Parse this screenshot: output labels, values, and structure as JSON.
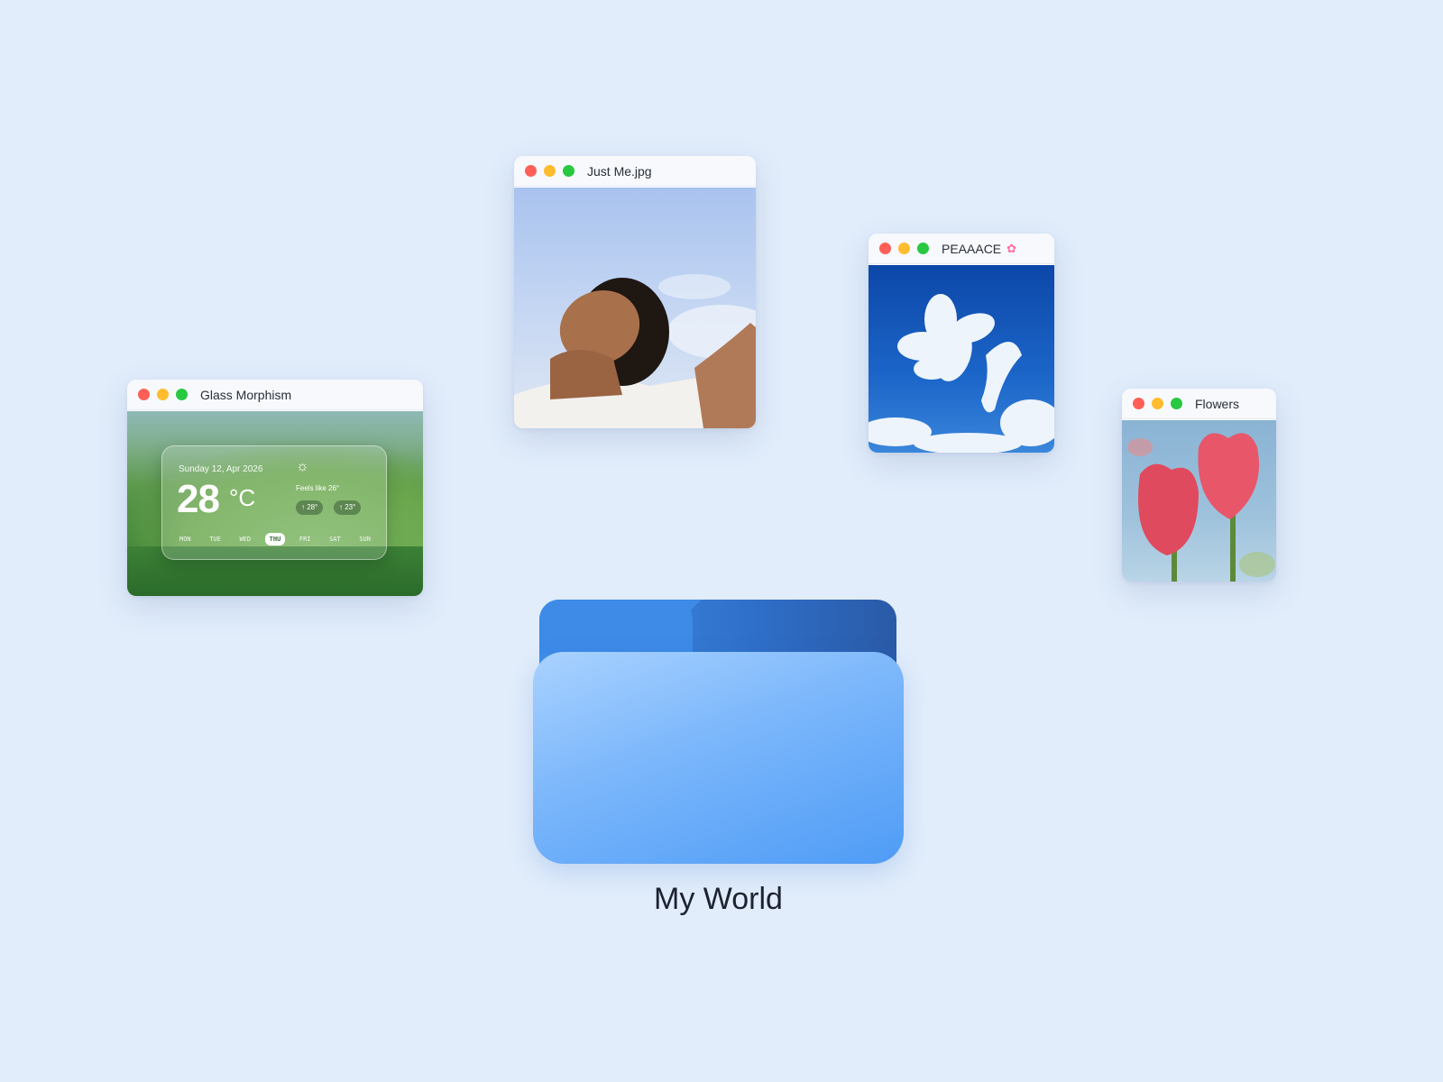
{
  "windows": {
    "weather": {
      "title": "Glass Morphism",
      "widget": {
        "date": "Sunday 12, Apr 2026",
        "temperature": "28",
        "unit": "°C",
        "feels_like": "Feels like 26°",
        "high": "↑ 28°",
        "low": "↑ 23°",
        "days": [
          "MON",
          "TUE",
          "WED",
          "THU",
          "FRI",
          "SAT",
          "SUN"
        ],
        "selected_day": "THU"
      }
    },
    "photo": {
      "title": "Just Me.jpg"
    },
    "cloud": {
      "title": "PEAAACE"
    },
    "flowers": {
      "title": "Flowers"
    }
  },
  "folder": {
    "label": "My World",
    "color": "#4f9cf6"
  },
  "colors": {
    "background": "#e1edfb",
    "close": "#ff5f57",
    "minimize": "#febc2e",
    "maximize": "#28c840"
  }
}
